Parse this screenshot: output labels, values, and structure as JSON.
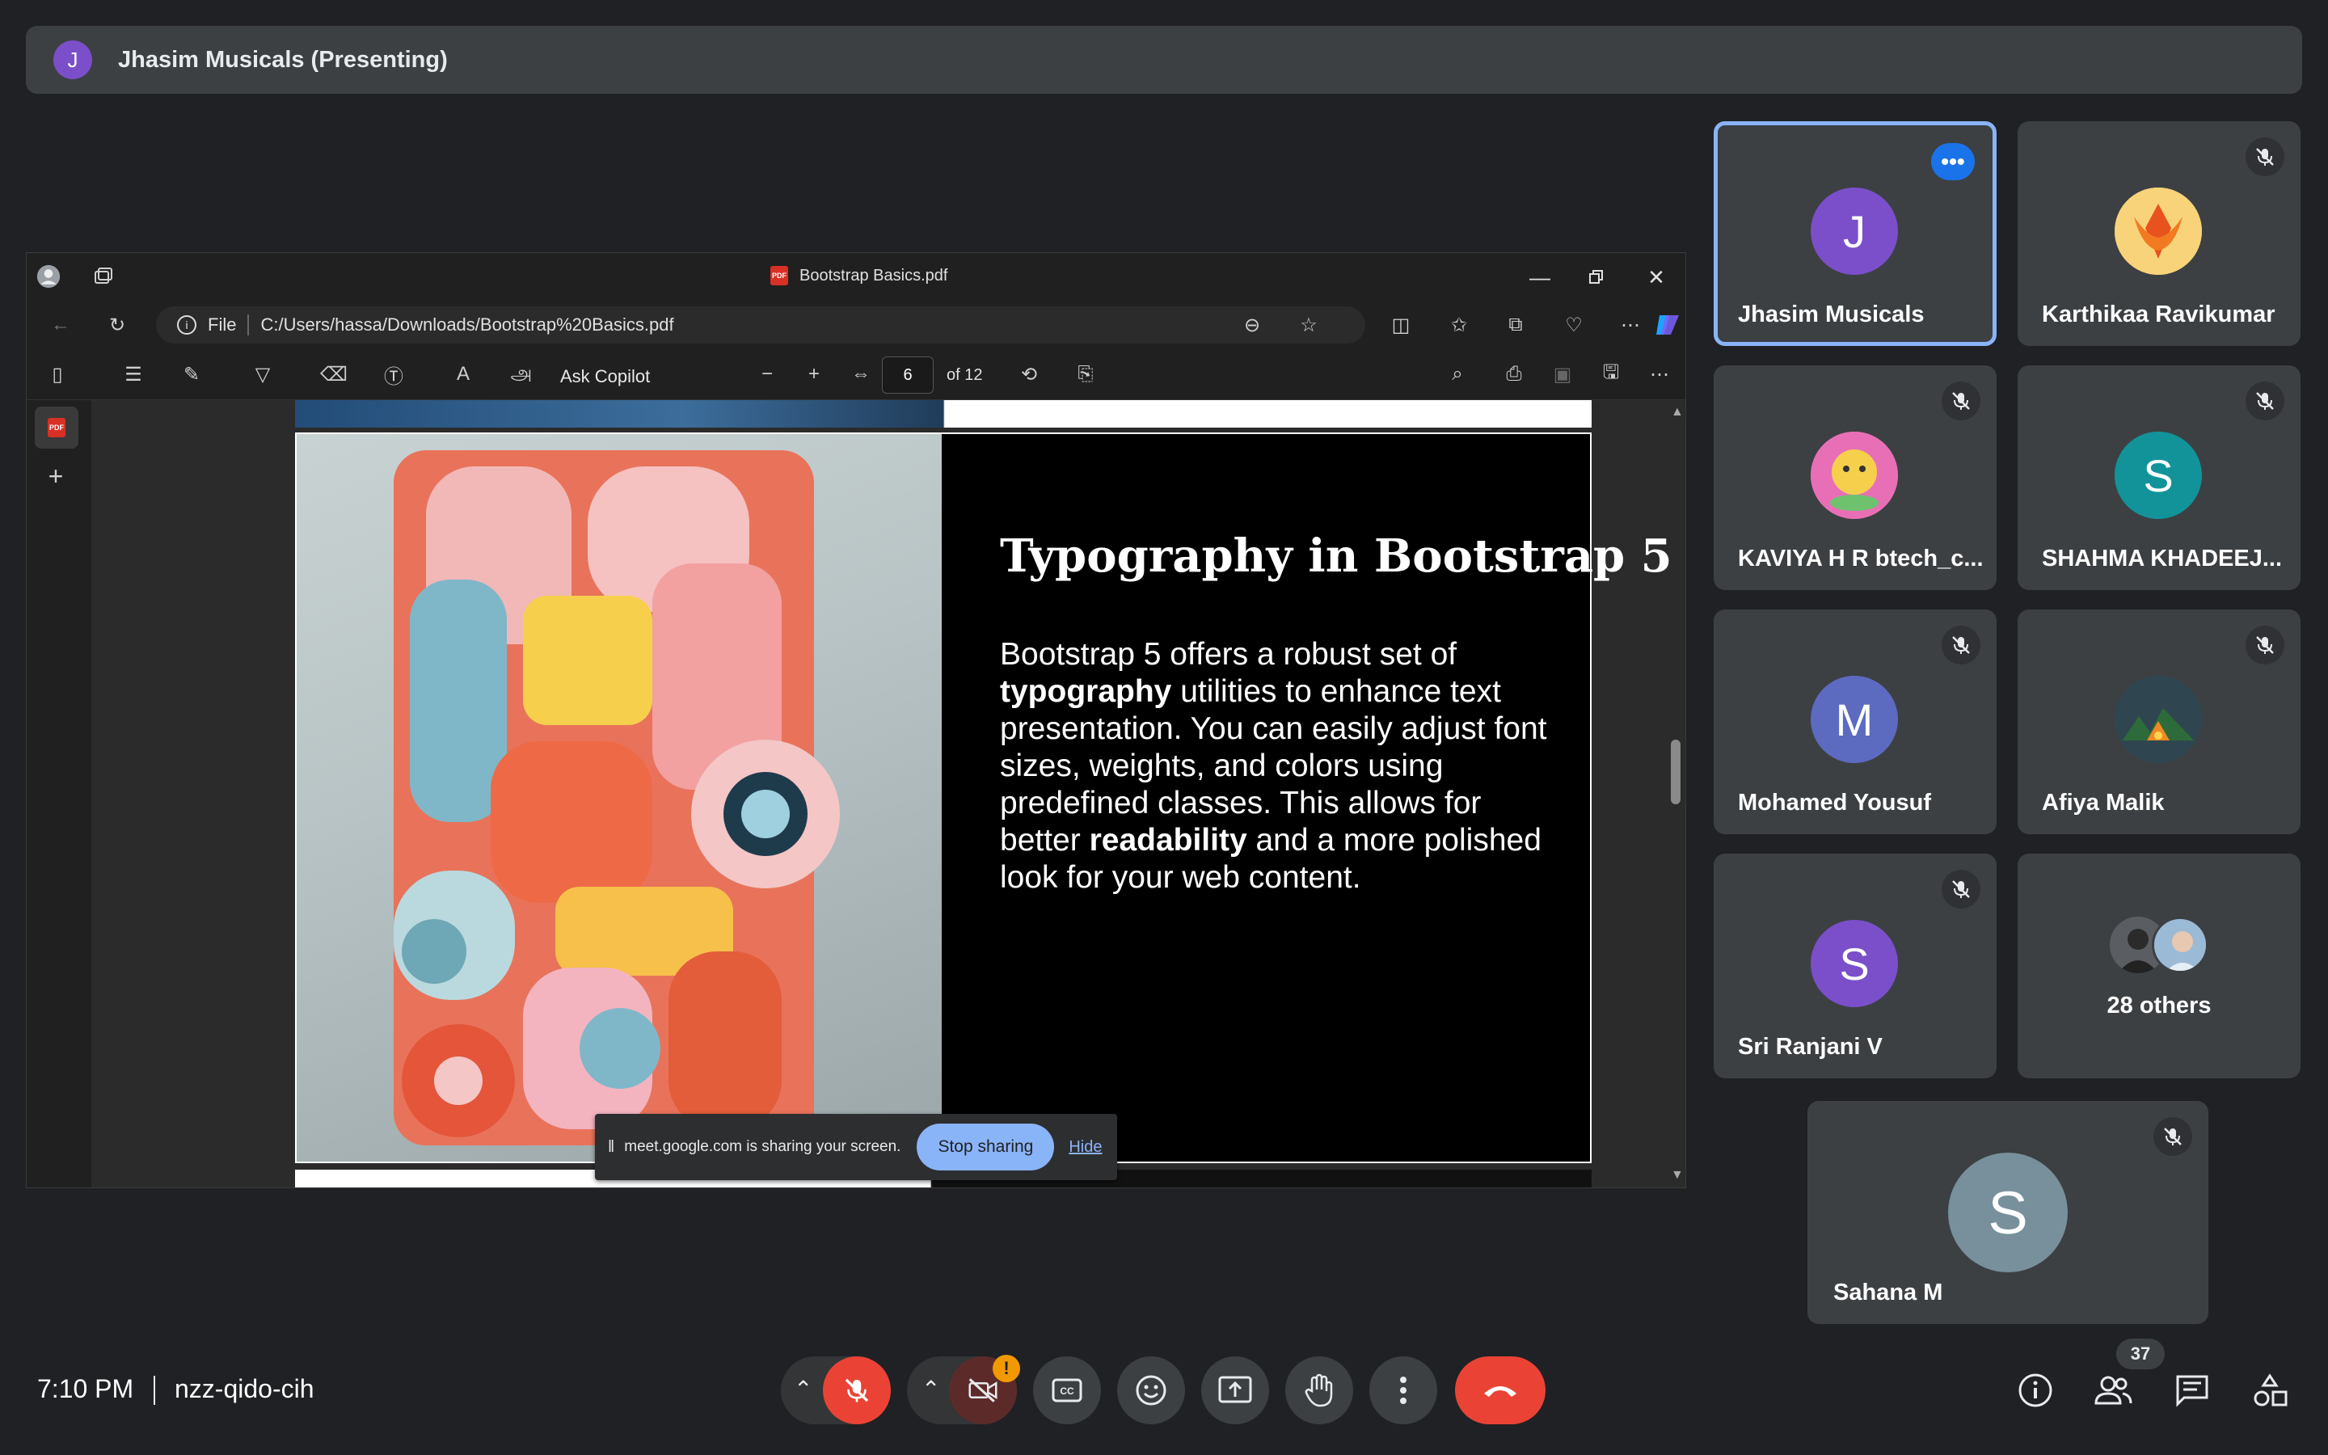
{
  "presenter_bar": {
    "initial": "J",
    "label": "Jhasim Musicals (Presenting)"
  },
  "shared_window": {
    "title": "Bootstrap Basics.pdf",
    "address": {
      "scheme": "File",
      "path": "C:/Users/hassa/Downloads/Bootstrap%20Basics.pdf"
    },
    "toolbar": {
      "ask_copilot": "Ask Copilot",
      "page_value": "6",
      "page_of": "of 12"
    },
    "slide": {
      "title": "Typography in Bootstrap 5",
      "body_parts": [
        "Bootstrap 5 offers a robust set of ",
        "typography",
        " utilities to enhance text presentation. You can easily adjust font sizes, weights, and colors using predefined classes. This allows for better ",
        "readability",
        " and a more polished look for your web content."
      ]
    },
    "pdf_badge": "PDF"
  },
  "share_notice": {
    "text": "meet.google.com is sharing your screen.",
    "stop_label": "Stop sharing",
    "hide_label": "Hide"
  },
  "participants": [
    {
      "name": "Jhasim Musicals",
      "initial": "J",
      "color": "#7b4fc9",
      "active": true
    },
    {
      "name": "Karthikaa Ravikumar",
      "initial": "",
      "color": "#f6b23a"
    },
    {
      "name": "KAVIYA H R btech_c...",
      "initial": "",
      "color": "#e65fa8"
    },
    {
      "name": "SHAHMA KHADEEJ...",
      "initial": "S",
      "color": "#12939a"
    },
    {
      "name": "Mohamed Yousuf",
      "initial": "M",
      "color": "#5c6bc0"
    },
    {
      "name": "Afiya Malik",
      "initial": "",
      "color": "#3d5a5b"
    },
    {
      "name": "Sri Ranjani V",
      "initial": "S",
      "color": "#7b4fc9"
    },
    {
      "name": "28 others",
      "initial": "",
      "color": "#4a4d51"
    },
    {
      "name": "Sahana M",
      "initial": "S",
      "color": "#78909c"
    }
  ],
  "bottom_bar": {
    "time": "7:10 PM",
    "meeting_code": "nzz-qido-cih",
    "people_count": "37"
  },
  "colors": {
    "bg": "#202124",
    "tile": "#3c4043",
    "accent": "#8ab4f8",
    "danger": "#ea4335"
  }
}
